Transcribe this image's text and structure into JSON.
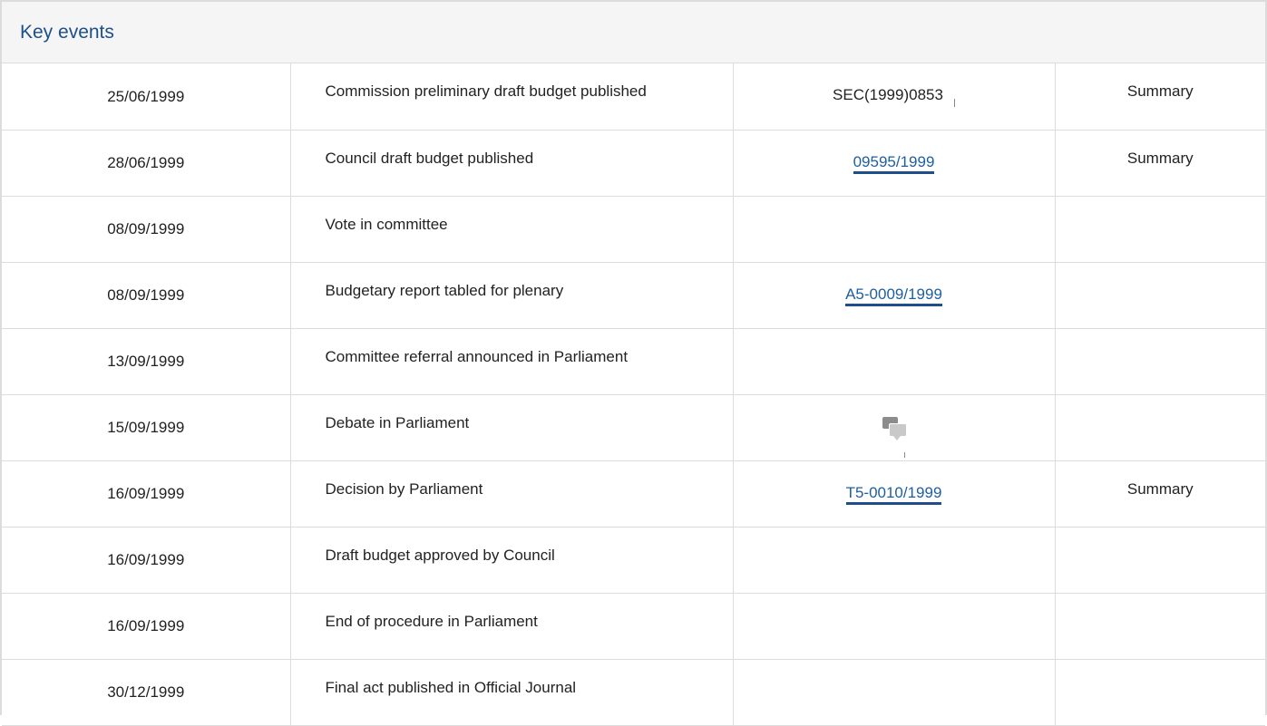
{
  "panel": {
    "title": "Key events"
  },
  "events": [
    {
      "date": "25/06/1999",
      "event": "Commission preliminary draft budget published",
      "doc": "SEC(1999)0853",
      "doc_link": false,
      "summary": "Summary"
    },
    {
      "date": "28/06/1999",
      "event": "Council draft budget published",
      "doc": "09595/1999",
      "doc_link": true,
      "summary": "Summary"
    },
    {
      "date": "08/09/1999",
      "event": "Vote in committee",
      "doc": "",
      "doc_link": false,
      "summary": ""
    },
    {
      "date": "08/09/1999",
      "event": "Budgetary report tabled for plenary",
      "doc": "A5-0009/1999",
      "doc_link": true,
      "summary": ""
    },
    {
      "date": "13/09/1999",
      "event": "Committee referral announced in Parliament",
      "doc": "",
      "doc_link": false,
      "summary": ""
    },
    {
      "date": "15/09/1999",
      "event": "Debate in Parliament",
      "doc": "",
      "doc_icon": "debate-icon",
      "doc_link": false,
      "summary": ""
    },
    {
      "date": "16/09/1999",
      "event": "Decision by Parliament",
      "doc": "T5-0010/1999",
      "doc_link": true,
      "summary": "Summary"
    },
    {
      "date": "16/09/1999",
      "event": "Draft budget approved by Council",
      "doc": "",
      "doc_link": false,
      "summary": ""
    },
    {
      "date": "16/09/1999",
      "event": "End of procedure in Parliament",
      "doc": "",
      "doc_link": false,
      "summary": ""
    },
    {
      "date": "30/12/1999",
      "event": "Final act published in Official Journal",
      "doc": "",
      "doc_link": false,
      "summary": ""
    }
  ],
  "colors": {
    "title": "#1e4f8a",
    "link": "#1e5fa0",
    "border": "#dcdcdc",
    "header_bg": "#f5f5f5"
  }
}
